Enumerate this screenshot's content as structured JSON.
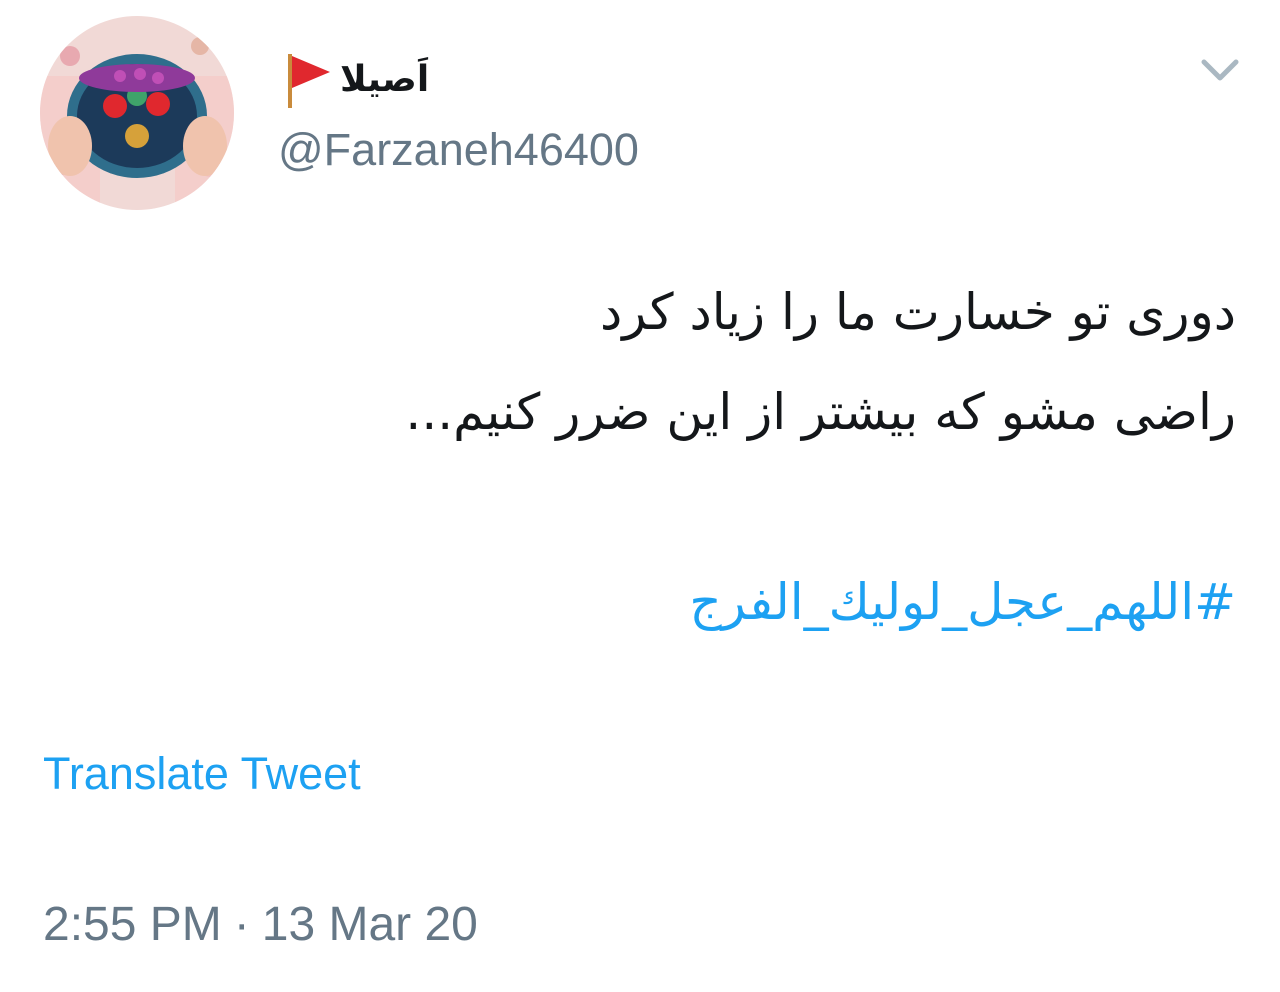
{
  "author": {
    "display_name": "اَصیلا",
    "flag_icon": "red-flag-icon",
    "handle": "@Farzaneh46400"
  },
  "menu": {
    "icon": "chevron-down-icon"
  },
  "tweet": {
    "lines": [
      "دوری تو خسارت ما را زیاد کرد",
      "راضی مشو که بیشتر از این ضرر کنیم..."
    ],
    "hashtag": "#اللهم_عجل_لوليك_الفرج"
  },
  "actions": {
    "translate": "Translate Tweet"
  },
  "meta": {
    "time": "2:55 PM",
    "separator": "·",
    "date": "13 Mar 20"
  },
  "colors": {
    "text": "#14171a",
    "secondary": "#657786",
    "link": "#1da1f2",
    "flag": "#e0282e"
  }
}
